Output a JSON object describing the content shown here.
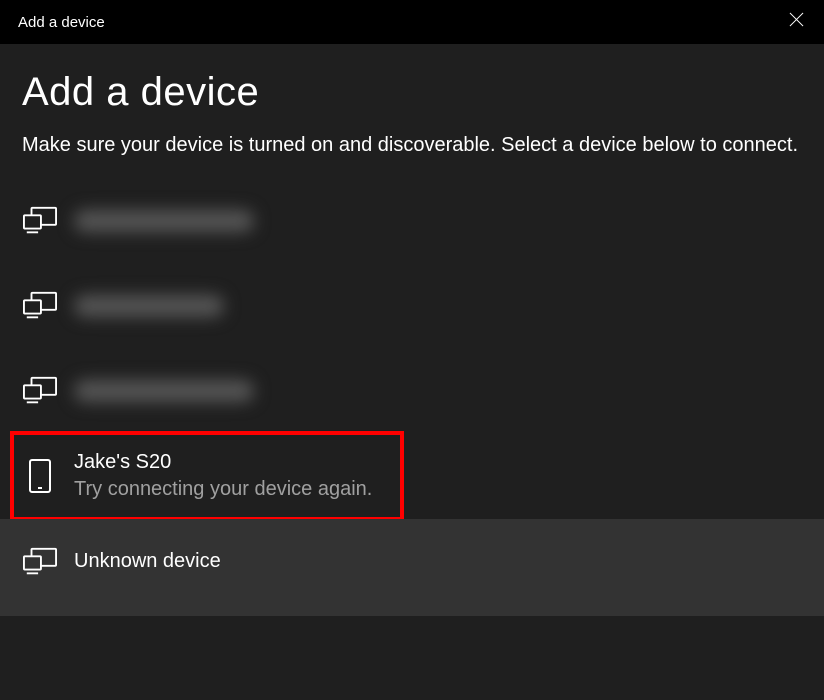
{
  "titlebar": {
    "title": "Add a device"
  },
  "heading": "Add a device",
  "instruction": "Make sure your device is turned on and discoverable. Select a device below to connect.",
  "devices": [
    {
      "name": "Unknown device",
      "blurred": true,
      "icon": "display"
    },
    {
      "name": "Unknown device",
      "blurred": true,
      "icon": "display"
    },
    {
      "name": "Unknown device",
      "blurred": true,
      "icon": "display"
    },
    {
      "name": "Jake's S20",
      "subtext": "Try connecting your device again.",
      "icon": "phone",
      "highlighted": true
    },
    {
      "name": "Unknown device",
      "icon": "display",
      "hovered": true
    }
  ]
}
